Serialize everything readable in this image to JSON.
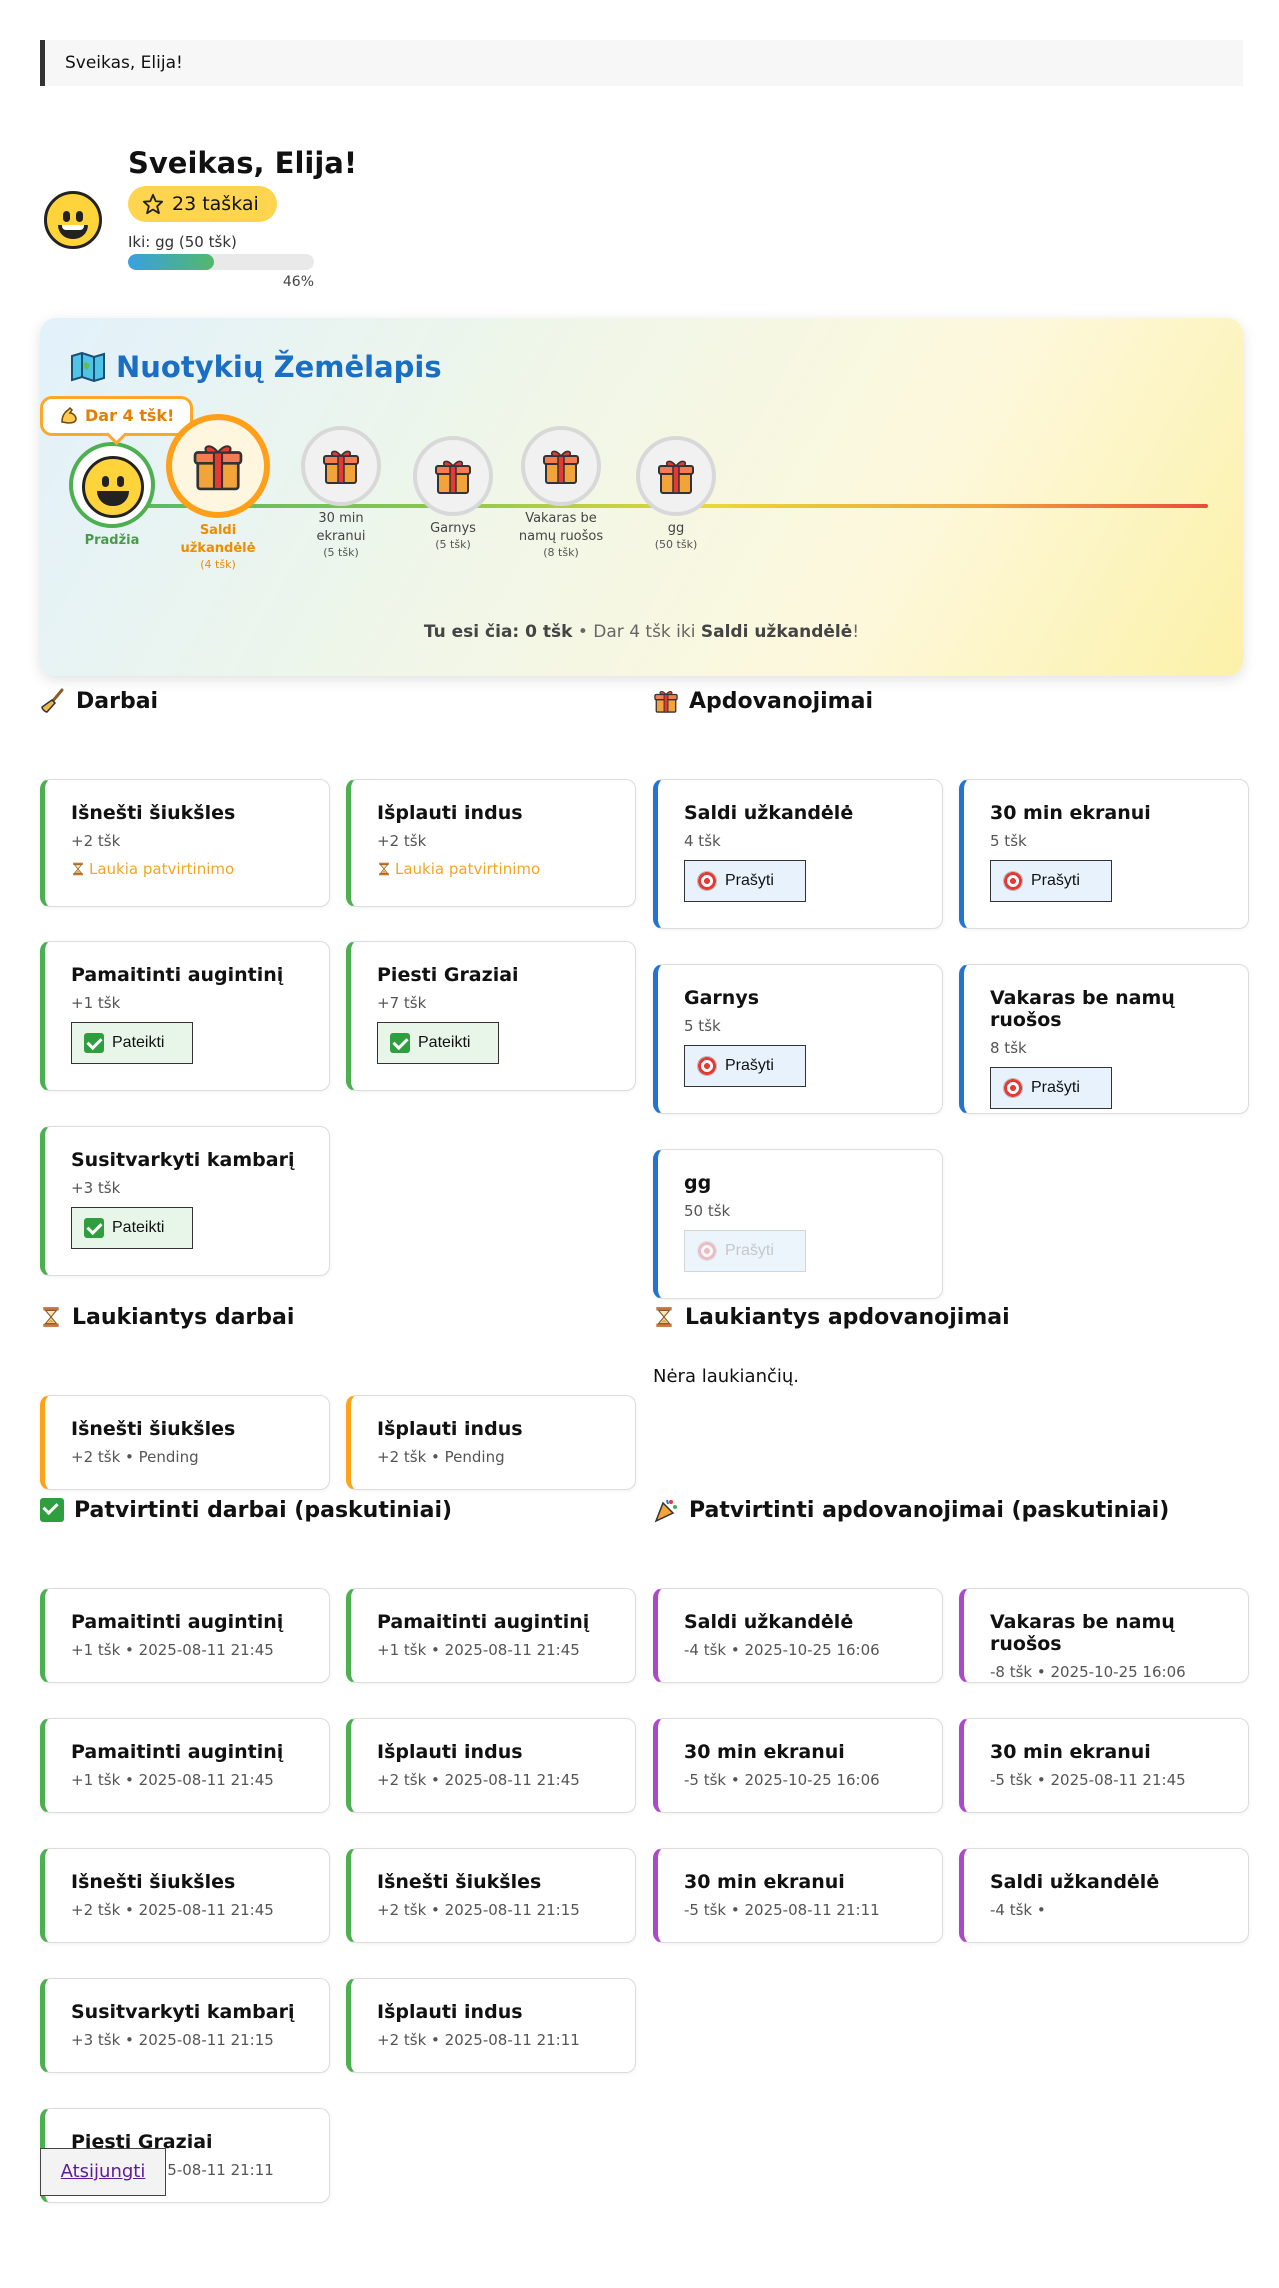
{
  "banner": "Sveikas, Elija!",
  "profile": {
    "name": "Sveikas, Elija!",
    "points": "23 taškai",
    "goal_label": "Iki: gg (50 tšk)",
    "progress": 0.46,
    "progress_text": "46%"
  },
  "map": {
    "title": "Nuotykių Žemėlapis",
    "tip": "Dar 4 tšk!",
    "start": "Pradžia",
    "nodes": [
      {
        "label": "Saldi užkandėlė",
        "sub": "(4 tšk)"
      },
      {
        "label": "30 min ekranui",
        "sub": "(5 tšk)"
      },
      {
        "label": "Garnys",
        "sub": "(5 tšk)"
      },
      {
        "label": "Vakaras be namų ruošos",
        "sub": "(8 tšk)"
      },
      {
        "label": "gg",
        "sub": "(50 tšk)"
      }
    ],
    "foot_pre": "Tu esi čia: 0 tšk",
    "foot_mid": " • Dar 4 tšk iki ",
    "foot_target": "Saldi užkandėlė",
    "foot_end": "!"
  },
  "chores": {
    "title": "Darbai",
    "waiting_text": "Laukia patvirtinimo",
    "submit_label": "Pateikti",
    "items": [
      {
        "title": "Išnešti šiukšles",
        "pts": "+2 tšk"
      },
      {
        "title": "Išplauti indus",
        "pts": "+2 tšk"
      },
      {
        "title": "Pamaitinti augintinį",
        "pts": "+1 tšk"
      },
      {
        "title": "Piesti Graziai",
        "pts": "+7 tšk"
      },
      {
        "title": "Susitvarkyti kambarį",
        "pts": "+3 tšk"
      }
    ]
  },
  "rewards": {
    "title": "Apdovanojimai",
    "ask_label": "Prašyti",
    "items": [
      {
        "title": "Saldi užkandėlė",
        "pts": "4 tšk"
      },
      {
        "title": "30 min ekranui",
        "pts": "5 tšk"
      },
      {
        "title": "Garnys",
        "pts": "5 tšk"
      },
      {
        "title": "Vakaras be namų ruošos",
        "pts": "8 tšk"
      },
      {
        "title": "gg",
        "pts": "50 tšk"
      }
    ]
  },
  "pending_chores": {
    "title": "Laukiantys darbai",
    "items": [
      {
        "title": "Išnešti šiukšles",
        "meta": "+2 tšk • Pending"
      },
      {
        "title": "Išplauti indus",
        "meta": "+2 tšk • Pending"
      }
    ]
  },
  "pending_rewards": {
    "title": "Laukiantys apdovanojimai",
    "empty": "Nėra laukiančių."
  },
  "approved_chores": {
    "title": "Patvirtinti darbai (paskutiniai)",
    "items": [
      {
        "title": "Pamaitinti augintinį",
        "meta": "+1 tšk • 2025-08-11 21:45"
      },
      {
        "title": "Pamaitinti augintinį",
        "meta": "+1 tšk • 2025-08-11 21:45"
      },
      {
        "title": "Pamaitinti augintinį",
        "meta": "+1 tšk • 2025-08-11 21:45"
      },
      {
        "title": "Išplauti indus",
        "meta": "+2 tšk • 2025-08-11 21:45"
      },
      {
        "title": "Išnešti šiukšles",
        "meta": "+2 tšk • 2025-08-11 21:45"
      },
      {
        "title": "Išnešti šiukšles",
        "meta": "+2 tšk • 2025-08-11 21:15"
      },
      {
        "title": "Susitvarkyti kambarį",
        "meta": "+3 tšk • 2025-08-11 21:15"
      },
      {
        "title": "Išplauti indus",
        "meta": "+2 tšk • 2025-08-11 21:11"
      },
      {
        "title": "Piesti Graziai",
        "meta": "+7 tšk • 2025-08-11 21:11"
      }
    ]
  },
  "approved_rewards": {
    "title": "Patvirtinti apdovanojimai (paskutiniai)",
    "items": [
      {
        "title": "Saldi užkandėlė",
        "meta": "-4 tšk • 2025-10-25 16:06"
      },
      {
        "title": "Vakaras be namų ruošos",
        "meta": "-8 tšk • 2025-10-25 16:06"
      },
      {
        "title": "30 min ekranui",
        "meta": "-5 tšk • 2025-10-25 16:06"
      },
      {
        "title": "30 min ekranui",
        "meta": "-5 tšk • 2025-08-11 21:45"
      },
      {
        "title": "30 min ekranui",
        "meta": "-5 tšk • 2025-08-11 21:11"
      },
      {
        "title": "Saldi užkandėlė",
        "meta": "-4 tšk •"
      }
    ]
  },
  "logout": "Atsijungti",
  "colors": {
    "accent_blue": "#2374d1",
    "green": "#4caf50",
    "orange": "#ffa31a",
    "purple": "#a94bc8"
  }
}
